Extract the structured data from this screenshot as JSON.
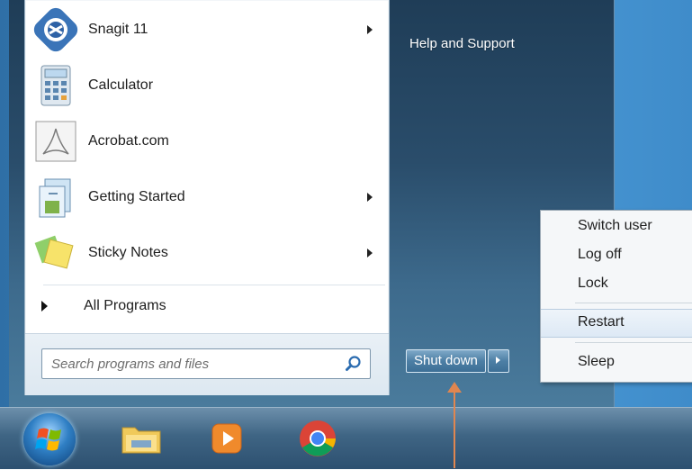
{
  "programs": [
    {
      "label": "Snagit 11",
      "icon": "snagit-icon",
      "has_submenu": true
    },
    {
      "label": "Calculator",
      "icon": "calculator-icon",
      "has_submenu": false
    },
    {
      "label": "Acrobat.com",
      "icon": "acrobat-icon",
      "has_submenu": false
    },
    {
      "label": "Getting Started",
      "icon": "getting-started-icon",
      "has_submenu": true
    },
    {
      "label": "Sticky Notes",
      "icon": "sticky-notes-icon",
      "has_submenu": true
    }
  ],
  "all_programs": {
    "label": "All Programs"
  },
  "search": {
    "placeholder": "Search programs and files"
  },
  "right_pane": {
    "help_label": "Help and Support"
  },
  "shutdown": {
    "label": "Shut down"
  },
  "power_menu": {
    "items": [
      "Switch user",
      "Log off",
      "Lock",
      "Restart",
      "Sleep"
    ],
    "highlighted": "Restart"
  },
  "taskbar": {
    "items": [
      "start-orb-icon",
      "windows-explorer-icon",
      "media-player-icon",
      "chrome-icon"
    ]
  },
  "colors": {
    "annotation_arrow": "#e08650",
    "start_menu_glass": "#2a4d6b"
  }
}
